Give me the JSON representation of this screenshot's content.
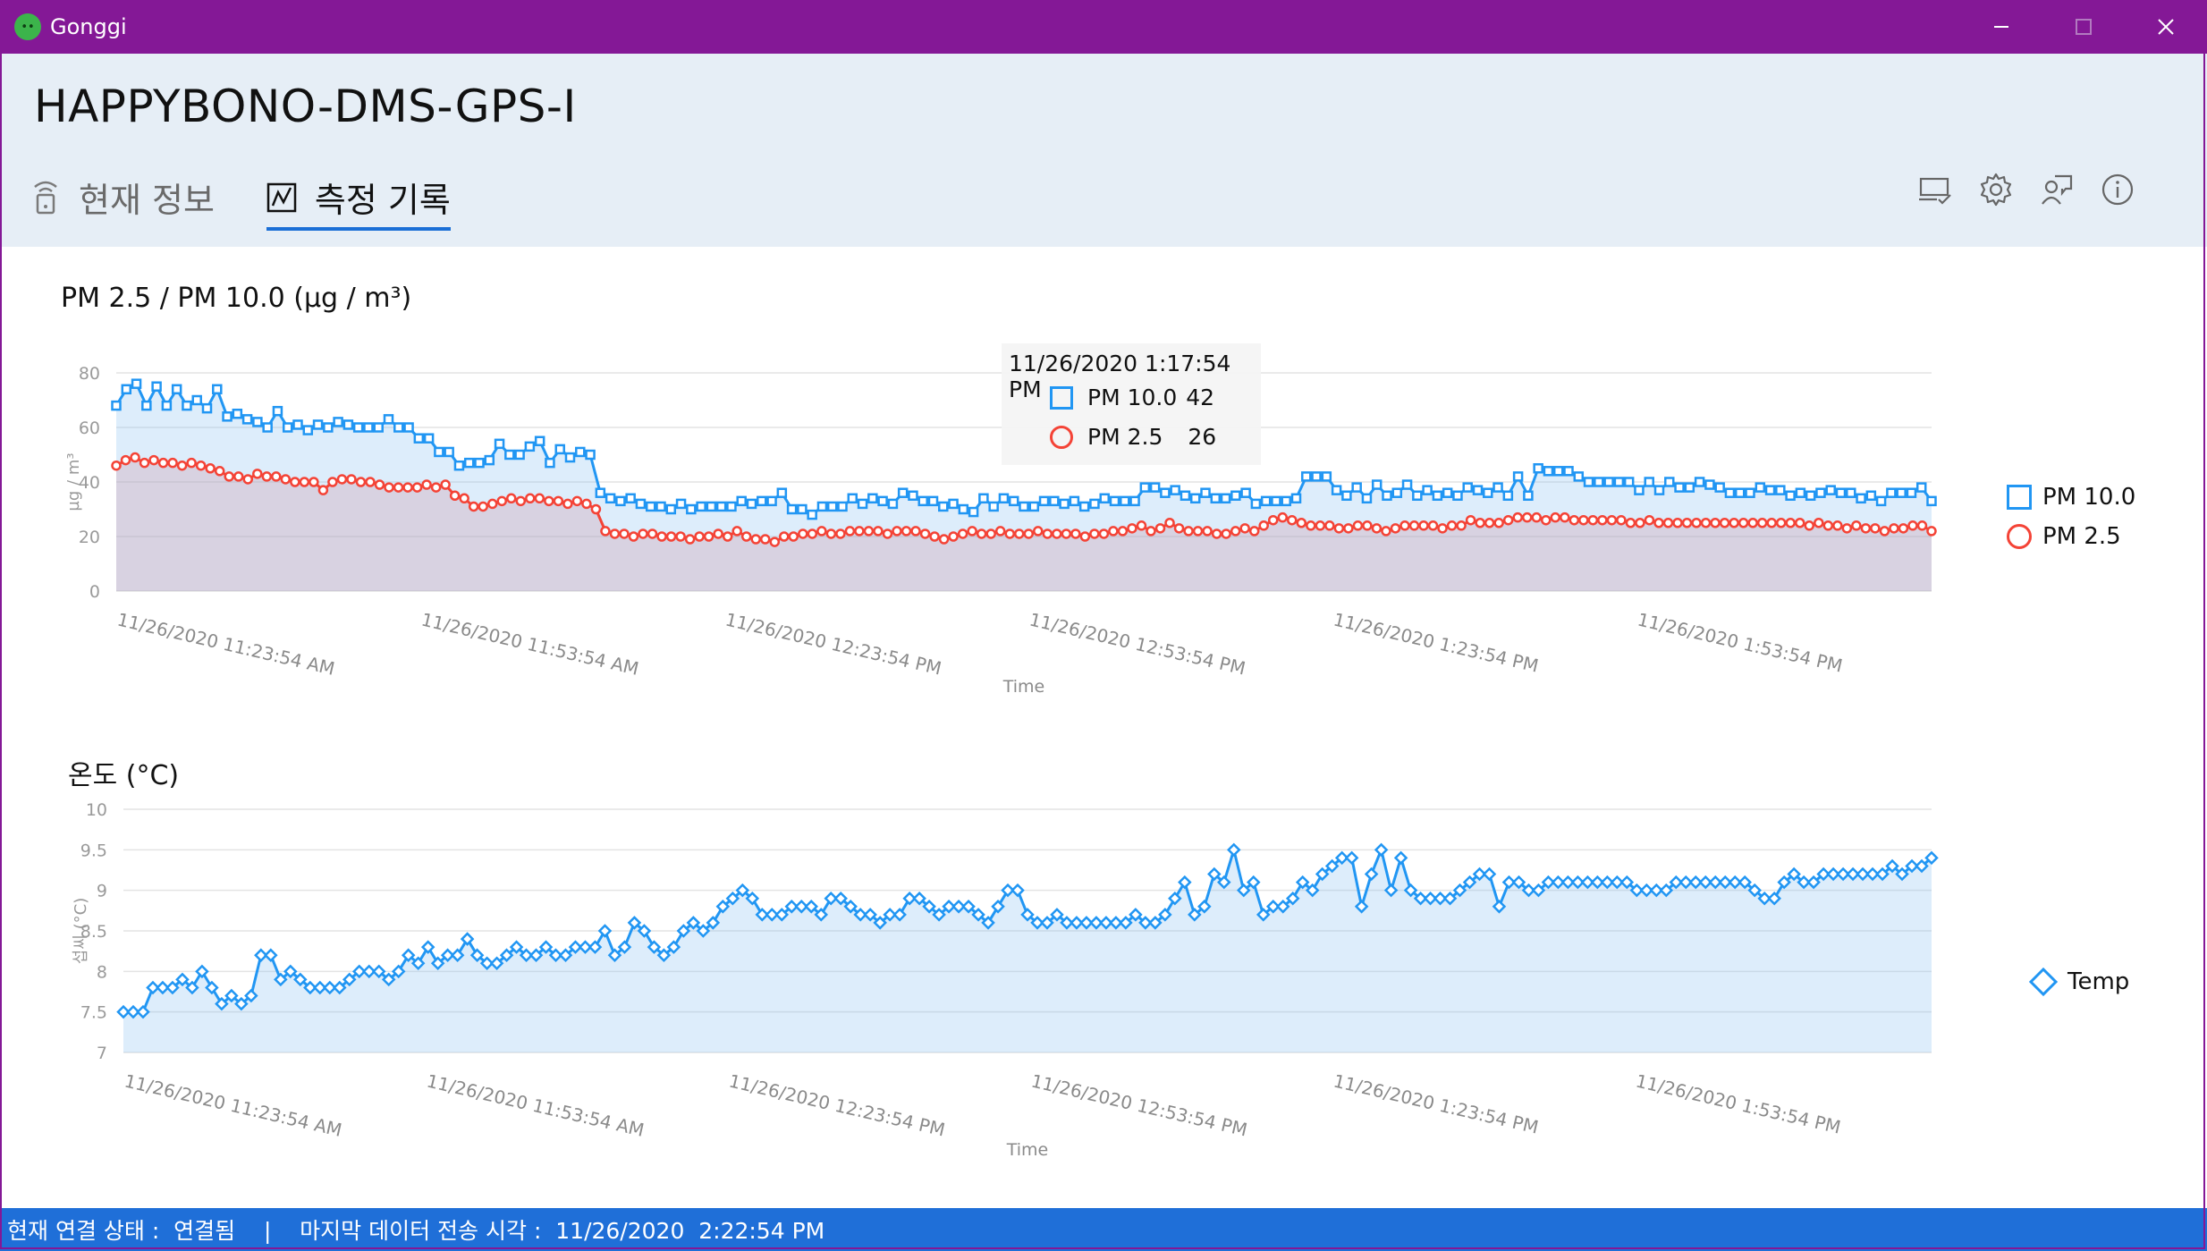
{
  "window": {
    "title": "Gonggi",
    "controls": [
      "minimize",
      "maximize",
      "close"
    ]
  },
  "header": {
    "device_name": "HAPPYBONO-DMS-GPS-I",
    "tabs": [
      {
        "label": "현재 정보",
        "icon": "wifi-device-icon",
        "active": false
      },
      {
        "label": "측정 기록",
        "icon": "chart-icon",
        "active": true
      }
    ],
    "toolbar": [
      "device-check-icon",
      "settings-icon",
      "feedback-icon",
      "info-icon"
    ]
  },
  "pm_chart": {
    "title": "PM 2.5 / PM 10.0 (µg / m³)",
    "ylabel": "µg / m³",
    "xlabel": "Time",
    "legend": [
      "PM 10.0",
      "PM 2.5"
    ],
    "tooltip": {
      "time": "11/26/2020 1:17:54 PM",
      "rows": [
        {
          "label": "PM 10.0",
          "value": "42"
        },
        {
          "label": "PM 2.5",
          "value": "26"
        }
      ]
    }
  },
  "temp_chart": {
    "title": "온도 (°C)",
    "ylabel": "섭씨 (°C)",
    "xlabel": "Time",
    "legend": [
      "Temp"
    ]
  },
  "chart_data": [
    {
      "type": "line",
      "title": "PM 2.5 / PM 10.0 (µg / m³)",
      "xlabel": "Time",
      "ylabel": "µg / m³",
      "ylim": [
        0,
        80
      ],
      "yticks": [
        "0",
        "20",
        "40",
        "60",
        "80"
      ],
      "xticks": [
        "11/26/2020 11:23:54 AM",
        "11/26/2020 11:53:54 AM",
        "11/26/2020 12:23:54 PM",
        "11/26/2020 12:53:54 PM",
        "11/26/2020 1:23:54 PM",
        "11/26/2020 1:53:54 PM"
      ],
      "legend_position": "right",
      "grid": true,
      "colors": {
        "PM 10.0": "#2196f3",
        "PM 2.5": "#f44336"
      },
      "series": [
        {
          "name": "PM 10.0",
          "marker": "square",
          "values": [
            68,
            74,
            76,
            68,
            75,
            68,
            74,
            68,
            70,
            67,
            74,
            64,
            65,
            63,
            62,
            60,
            66,
            60,
            61,
            59,
            61,
            60,
            62,
            61,
            60,
            60,
            60,
            63,
            60,
            60,
            56,
            56,
            51,
            51,
            46,
            47,
            47,
            48,
            54,
            50,
            50,
            53,
            55,
            47,
            52,
            49,
            51,
            50,
            36,
            34,
            33,
            34,
            32,
            31,
            31,
            30,
            32,
            30,
            31,
            31,
            31,
            31,
            33,
            32,
            33,
            33,
            36,
            30,
            30,
            28,
            31,
            31,
            31,
            34,
            32,
            34,
            33,
            32,
            36,
            35,
            33,
            33,
            31,
            32,
            30,
            29,
            34,
            31,
            34,
            33,
            31,
            31,
            33,
            33,
            32,
            33,
            31,
            32,
            34,
            33,
            33,
            33,
            38,
            38,
            36,
            37,
            35,
            34,
            36,
            34,
            34,
            35,
            36,
            32,
            33,
            33,
            33,
            34,
            42,
            42,
            42,
            37,
            35,
            38,
            34,
            39,
            35,
            36,
            39,
            35,
            37,
            35,
            36,
            35,
            38,
            37,
            36,
            38,
            35,
            42,
            35,
            45,
            44,
            44,
            44,
            42,
            40,
            40,
            40,
            40,
            40,
            37,
            40,
            37,
            40,
            38,
            38,
            40,
            39,
            38,
            36,
            36,
            36,
            38,
            37,
            37,
            35,
            36,
            35,
            36,
            37,
            36,
            36,
            34,
            35,
            33,
            36,
            36,
            36,
            38,
            33
          ]
        },
        {
          "name": "PM 2.5",
          "marker": "circle",
          "values": [
            46,
            48,
            49,
            47,
            48,
            47,
            47,
            46,
            47,
            46,
            45,
            44,
            42,
            42,
            41,
            43,
            42,
            42,
            41,
            40,
            40,
            40,
            37,
            40,
            41,
            41,
            40,
            40,
            39,
            38,
            38,
            38,
            38,
            39,
            38,
            39,
            35,
            34,
            31,
            31,
            32,
            33,
            34,
            33,
            34,
            34,
            33,
            33,
            32,
            33,
            32,
            30,
            22,
            21,
            21,
            20,
            21,
            21,
            20,
            20,
            20,
            19,
            20,
            20,
            21,
            20,
            22,
            20,
            19,
            19,
            18,
            20,
            20,
            21,
            21,
            22,
            21,
            21,
            22,
            22,
            22,
            22,
            21,
            22,
            22,
            22,
            21,
            20,
            19,
            20,
            21,
            22,
            21,
            21,
            22,
            21,
            21,
            21,
            22,
            21,
            21,
            21,
            21,
            20,
            21,
            21,
            22,
            22,
            23,
            24,
            22,
            23,
            25,
            23,
            22,
            22,
            22,
            21,
            21,
            22,
            23,
            22,
            24,
            26,
            27,
            26,
            25,
            24,
            24,
            24,
            23,
            23,
            24,
            24,
            23,
            22,
            23,
            24,
            24,
            24,
            24,
            23,
            24,
            24,
            26,
            25,
            25,
            25,
            26,
            27,
            27,
            27,
            26,
            27,
            27,
            26,
            26,
            26,
            26,
            26,
            26,
            25,
            25,
            26,
            25,
            25,
            25,
            25,
            25,
            25,
            25,
            25,
            25,
            25,
            25,
            25,
            25,
            25,
            25,
            25,
            24,
            25,
            24,
            24,
            23,
            24,
            23,
            23,
            22,
            23,
            23,
            24,
            24,
            22
          ]
        }
      ]
    },
    {
      "type": "line",
      "title": "온도 (°C)",
      "xlabel": "Time",
      "ylabel": "섭씨 (°C)",
      "ylim": [
        7,
        10
      ],
      "yticks": [
        "7",
        "7.5",
        "8",
        "8.5",
        "9",
        "9.5",
        "10"
      ],
      "xticks": [
        "11/26/2020 11:23:54 AM",
        "11/26/2020 11:53:54 AM",
        "11/26/2020 12:23:54 PM",
        "11/26/2020 12:53:54 PM",
        "11/26/2020 1:23:54 PM",
        "11/26/2020 1:53:54 PM"
      ],
      "legend_position": "right",
      "grid": true,
      "colors": {
        "Temp": "#2196f3"
      },
      "series": [
        {
          "name": "Temp",
          "marker": "diamond",
          "values": [
            7.5,
            7.5,
            7.5,
            7.8,
            7.8,
            7.8,
            7.9,
            7.8,
            8.0,
            7.8,
            7.6,
            7.7,
            7.6,
            7.7,
            8.2,
            8.2,
            7.9,
            8.0,
            7.9,
            7.8,
            7.8,
            7.8,
            7.8,
            7.9,
            8.0,
            8.0,
            8.0,
            7.9,
            8.0,
            8.2,
            8.1,
            8.3,
            8.1,
            8.2,
            8.2,
            8.4,
            8.2,
            8.1,
            8.1,
            8.2,
            8.3,
            8.2,
            8.2,
            8.3,
            8.2,
            8.2,
            8.3,
            8.3,
            8.3,
            8.5,
            8.2,
            8.3,
            8.6,
            8.5,
            8.3,
            8.2,
            8.3,
            8.5,
            8.6,
            8.5,
            8.6,
            8.8,
            8.9,
            9.0,
            8.9,
            8.7,
            8.7,
            8.7,
            8.8,
            8.8,
            8.8,
            8.7,
            8.9,
            8.9,
            8.8,
            8.7,
            8.7,
            8.6,
            8.7,
            8.7,
            8.9,
            8.9,
            8.8,
            8.7,
            8.8,
            8.8,
            8.8,
            8.7,
            8.6,
            8.8,
            9.0,
            9.0,
            8.7,
            8.6,
            8.6,
            8.7,
            8.6,
            8.6,
            8.6,
            8.6,
            8.6,
            8.6,
            8.6,
            8.7,
            8.6,
            8.6,
            8.7,
            8.9,
            9.1,
            8.7,
            8.8,
            9.2,
            9.1,
            9.5,
            9.0,
            9.1,
            8.7,
            8.8,
            8.8,
            8.9,
            9.1,
            9.0,
            9.2,
            9.3,
            9.4,
            9.4,
            8.8,
            9.2,
            9.5,
            9.0,
            9.4,
            9.0,
            8.9,
            8.9,
            8.9,
            8.9,
            9.0,
            9.1,
            9.2,
            9.2,
            8.8,
            9.1,
            9.1,
            9.0,
            9.0,
            9.1,
            9.1,
            9.1,
            9.1,
            9.1,
            9.1,
            9.1,
            9.1,
            9.1,
            9.0,
            9.0,
            9.0,
            9.0,
            9.1,
            9.1,
            9.1,
            9.1,
            9.1,
            9.1,
            9.1,
            9.1,
            9.0,
            8.9,
            8.9,
            9.1,
            9.2,
            9.1,
            9.1,
            9.2,
            9.2,
            9.2,
            9.2,
            9.2,
            9.2,
            9.2,
            9.3,
            9.2,
            9.3,
            9.3,
            9.4
          ]
        }
      ]
    }
  ],
  "status_bar": {
    "text": "현재 연결 상태 :  연결됨    |    마지막 데이터 전송 시각 :  11/26/2020  2:22:54 PM"
  }
}
